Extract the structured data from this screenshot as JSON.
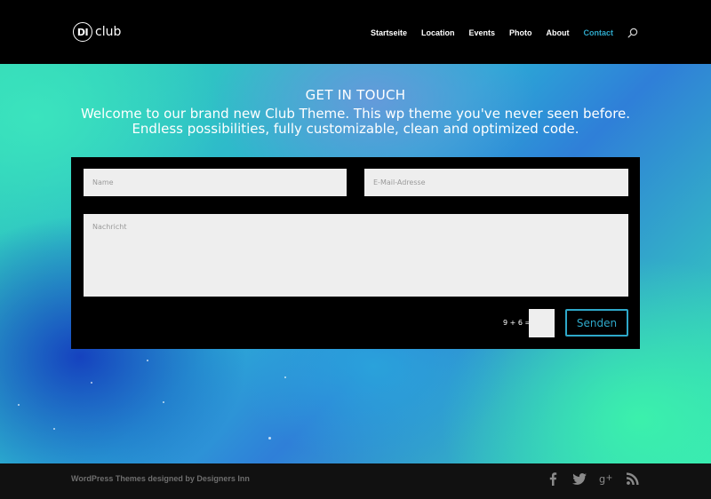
{
  "header": {
    "logo_badge": "DI",
    "logo_text": "club",
    "nav": [
      {
        "label": "Startseite"
      },
      {
        "label": "Location"
      },
      {
        "label": "Events"
      },
      {
        "label": "Photo"
      },
      {
        "label": "About"
      },
      {
        "label": "Contact",
        "active": true
      }
    ],
    "search_icon": "search-icon"
  },
  "hero": {
    "title": "GET IN TOUCH",
    "subtitle": "Welcome to our brand new Club Theme. This wp theme you've never seen before. Endless possibilities, fully customizable, clean and optimized code."
  },
  "form": {
    "name_placeholder": "Name",
    "email_placeholder": "E-Mail-Adresse",
    "message_placeholder": "Nachricht",
    "captcha_label": "9 + 6 =",
    "submit_label": "Senden"
  },
  "footer": {
    "credit": "WordPress Themes designed by Designers Inn",
    "social_icons": [
      "facebook-icon",
      "twitter-icon",
      "google-plus-icon",
      "rss-icon"
    ]
  },
  "colors": {
    "accent": "#2ea8c9",
    "header_bg": "#000000",
    "footer_bg": "#111111",
    "field_bg": "#eeeeee"
  }
}
